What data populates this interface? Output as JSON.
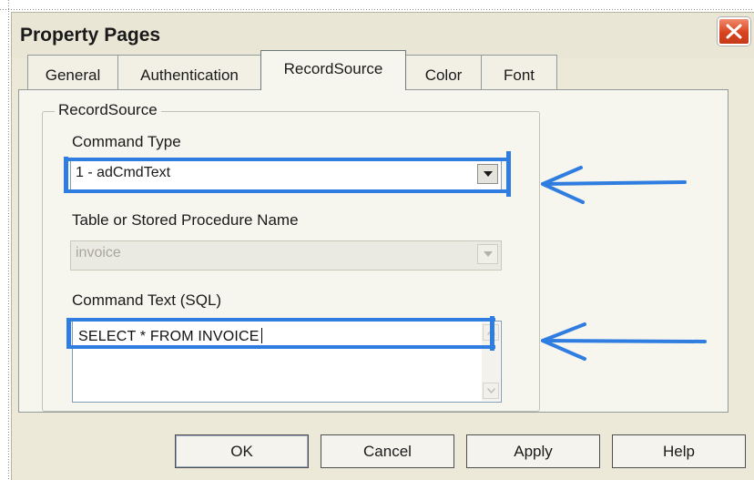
{
  "window": {
    "title": "Property Pages"
  },
  "tabs": [
    {
      "label": "General"
    },
    {
      "label": "Authentication"
    },
    {
      "label": "RecordSource",
      "active": true
    },
    {
      "label": "Color"
    },
    {
      "label": "Font"
    }
  ],
  "recordsource": {
    "group_label": "RecordSource",
    "command_type_label": "Command Type",
    "command_type_value": "1 - adCmdText",
    "table_label": "Table or Stored Procedure Name",
    "table_value": "invoice",
    "command_text_label": "Command Text (SQL)",
    "command_text_value": "SELECT * FROM INVOICE"
  },
  "buttons": {
    "ok": "OK",
    "cancel": "Cancel",
    "apply": "Apply",
    "help": "Help"
  },
  "annotations": {
    "color": "#2f7de0"
  },
  "icons": {
    "close": "close-icon",
    "dropdown": "chevron-down-icon",
    "arrow": "arrow-left-icon"
  }
}
